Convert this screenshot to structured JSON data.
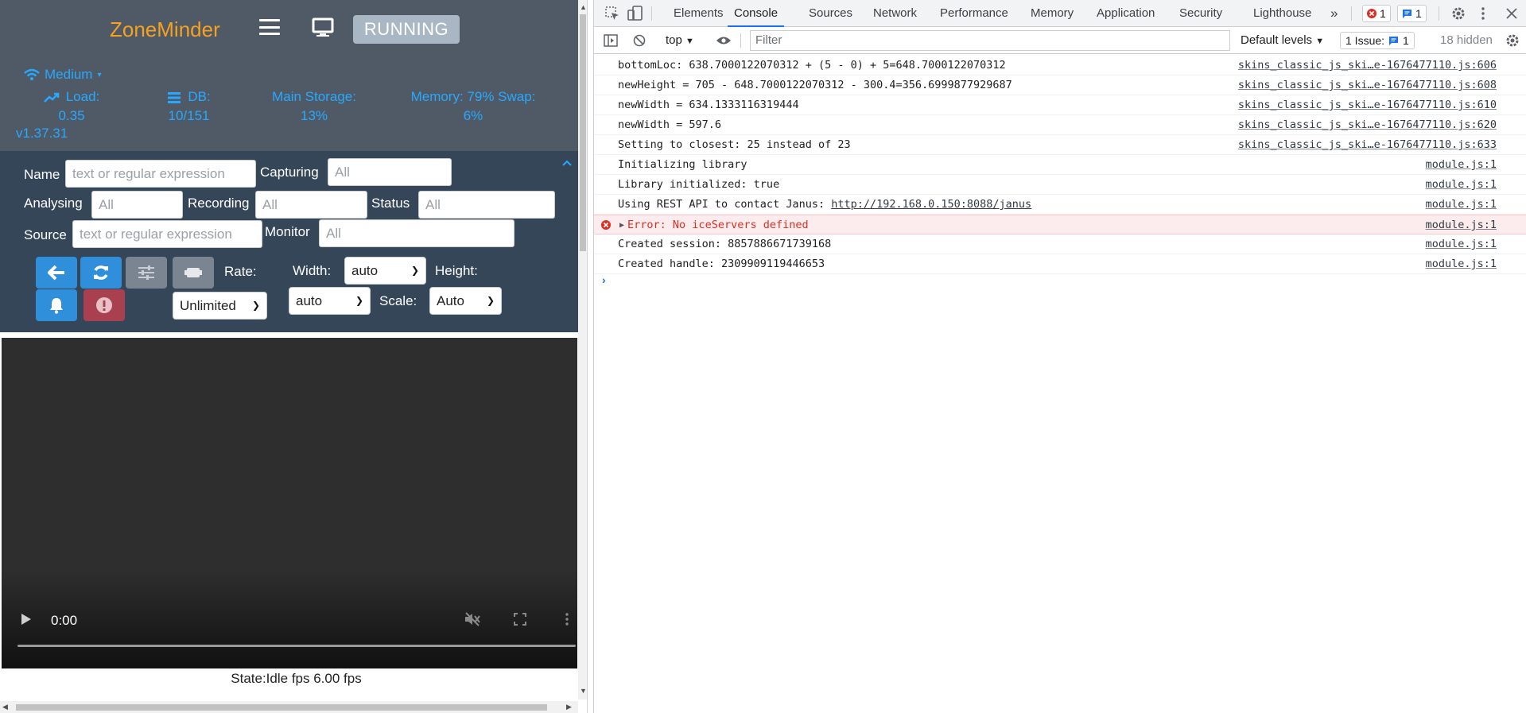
{
  "zm": {
    "logo": "ZoneMinder",
    "status": "RUNNING",
    "bandwidth": "Medium",
    "load_label": "Load:",
    "load_value": "0.35",
    "db_label": "DB:",
    "db_value": "10/151",
    "storage_label": "Main Storage:",
    "storage_value": "13%",
    "memory_label": "Memory: 79% Swap:",
    "memory_value": "6%",
    "version": "v1.37.31",
    "filters": {
      "name_label": "Name",
      "name_placeholder": "text or regular expression",
      "capturing_label": "Capturing",
      "capturing_value": "All",
      "analysing_label": "Analysing",
      "analysing_value": "All",
      "recording_label": "Recording",
      "recording_value": "All",
      "status_label": "Status",
      "status_value": "All",
      "source_label": "Source",
      "source_placeholder": "text or regular expression",
      "monitor_label": "Monitor",
      "monitor_value": "All"
    },
    "controls": {
      "rate_label": "Rate:",
      "rate_value": "Unlimited",
      "width_label": "Width:",
      "width_value": "auto",
      "height_label": "Height:",
      "height_value": "auto",
      "scale_label": "Scale:",
      "scale_value": "Auto"
    },
    "video": {
      "time": "0:00"
    },
    "state_text": "State:Idle fps 6.00 fps"
  },
  "devtools": {
    "tabs": [
      "Elements",
      "Console",
      "Sources",
      "Network",
      "Performance",
      "Memory",
      "Application",
      "Security",
      "Lighthouse"
    ],
    "active_tab": "Console",
    "error_count": "1",
    "message_count": "1",
    "context": "top",
    "filter_placeholder": "Filter",
    "levels": "Default levels",
    "issues_label": "1 Issue:",
    "issues_count": "1",
    "hidden": "18 hidden",
    "logs": [
      {
        "msg": "bottomLoc: 638.7000122070312 + (5 - 0) + 5=648.7000122070312",
        "src": "skins_classic_js_ski…e-1676477110.js:606",
        "type": "log"
      },
      {
        "msg": "newHeight = 705 - 648.7000122070312 - 300.4=356.6999877929687",
        "src": "skins_classic_js_ski…e-1676477110.js:608",
        "type": "log"
      },
      {
        "msg": "newWidth = 634.1333116319444",
        "src": "skins_classic_js_ski…e-1676477110.js:610",
        "type": "log"
      },
      {
        "msg": "newWidth = 597.6",
        "src": "skins_classic_js_ski…e-1676477110.js:620",
        "type": "log"
      },
      {
        "msg": "Setting to closest: 25 instead of 23",
        "src": "skins_classic_js_ski…e-1676477110.js:633",
        "type": "log"
      },
      {
        "msg": "Initializing library",
        "src": "module.js:1",
        "type": "log"
      },
      {
        "msg": "Library initialized: true",
        "src": "module.js:1",
        "type": "log"
      },
      {
        "msg": "Using REST API to contact Janus: ",
        "link": "http://192.168.0.150:8088/janus",
        "src": "module.js:1",
        "type": "log"
      },
      {
        "msg": "Error: No iceServers defined",
        "src": "module.js:1",
        "type": "error"
      },
      {
        "msg": "Created session: 8857886671739168",
        "src": "module.js:1",
        "type": "log"
      },
      {
        "msg": "Created handle: 2309909119446653",
        "src": "module.js:1",
        "type": "log"
      }
    ],
    "prompt": "›"
  },
  "colors": {
    "zm_header": "#505a66",
    "zm_filters": "#354659",
    "zm_logo": "#f6a21e",
    "zm_stat": "#26a9ff",
    "btn_blue": "#2f8fdb",
    "btn_red": "#a8404f",
    "devtools_accent": "#1a73e8",
    "error_red": "#d93025"
  }
}
